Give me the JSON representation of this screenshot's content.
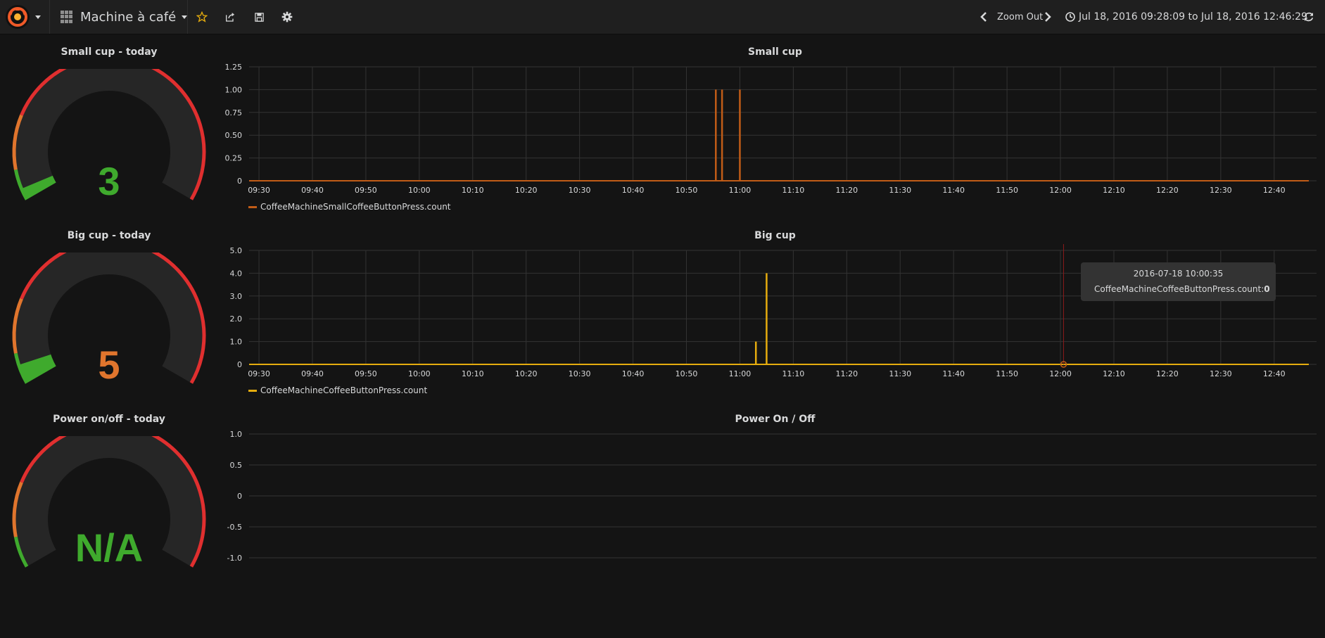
{
  "navbar": {
    "dashboard_title": "Machine à café",
    "zoom_out_label": "Zoom Out",
    "time_range": "Jul 18, 2016 09:28:09 to Jul 18, 2016 12:46:29"
  },
  "colors": {
    "background": "#141414",
    "navbar": "#1f1f1f",
    "gauge_red": "#e02f2f",
    "gauge_orange": "#e0752d",
    "gauge_green": "#3faa2d",
    "small_series": "#c15c17",
    "big_series": "#e5ac0e",
    "star": "#e5ac0e"
  },
  "icons": [
    "grafana-logo-icon",
    "dashboard-grid-icon",
    "star-icon",
    "share-icon",
    "save-icon",
    "cog-icon",
    "chevron-left-icon",
    "chevron-right-icon",
    "clock-icon",
    "refresh-icon"
  ],
  "gauges": [
    {
      "title": "Small cup - today",
      "value": "3",
      "numeric": 3,
      "value_color": "#3faa2d",
      "max": 100
    },
    {
      "title": "Big cup - today",
      "value": "5",
      "numeric": 5,
      "value_color": "#e0752d",
      "max": 100
    },
    {
      "title": "Power on/off - today",
      "value": "N/A",
      "numeric": null,
      "value_color": "#3faa2d",
      "max": 100
    }
  ],
  "graphs": {
    "small": {
      "title": "Small cup",
      "legend": "CoffeeMachineSmallCoffeeButtonPress.count"
    },
    "big": {
      "title": "Big cup",
      "legend": "CoffeeMachineCoffeeButtonPress.count"
    },
    "power": {
      "title": "Power On / Off"
    }
  },
  "tooltip": {
    "time": "2016-07-18 10:00:35",
    "series": "CoffeeMachineCoffeeButtonPress.count:",
    "value": "0"
  },
  "chart_data": [
    {
      "type": "line",
      "title": "Small cup",
      "x_ticks": [
        "09:30",
        "09:40",
        "09:50",
        "10:00",
        "10:10",
        "10:20",
        "10:30",
        "10:40",
        "10:50",
        "11:00",
        "11:10",
        "11:20",
        "11:30",
        "11:40",
        "11:50",
        "12:00",
        "12:10",
        "12:20",
        "12:30",
        "12:40"
      ],
      "y_ticks": [
        "0",
        "0.25",
        "0.50",
        "0.75",
        "1.00",
        "1.25"
      ],
      "ylim": [
        0,
        1.25
      ],
      "series": [
        {
          "name": "CoffeeMachineSmallCoffeeButtonPress.count",
          "color": "#c15c17",
          "spikes": [
            {
              "t": "10:55:30",
              "v": 1
            },
            {
              "t": "10:56:40",
              "v": 1
            },
            {
              "t": "11:00:00",
              "v": 1
            }
          ]
        }
      ]
    },
    {
      "type": "line",
      "title": "Big cup",
      "x_ticks": [
        "09:30",
        "09:40",
        "09:50",
        "10:00",
        "10:10",
        "10:20",
        "10:30",
        "10:40",
        "10:50",
        "11:00",
        "11:10",
        "11:20",
        "11:30",
        "11:40",
        "11:50",
        "12:00",
        "12:10",
        "12:20",
        "12:30",
        "12:40"
      ],
      "y_ticks": [
        "0",
        "1.0",
        "2.0",
        "3.0",
        "4.0",
        "5.0"
      ],
      "ylim": [
        0,
        5
      ],
      "series": [
        {
          "name": "CoffeeMachineCoffeeButtonPress.count",
          "color": "#e5ac0e",
          "spikes": [
            {
              "t": "11:03:00",
              "v": 1
            },
            {
              "t": "11:05:00",
              "v": 4
            }
          ]
        }
      ]
    },
    {
      "type": "line",
      "title": "Power On / Off",
      "y_ticks": [
        "-1.0",
        "-0.5",
        "0",
        "0.5",
        "1.0"
      ],
      "ylim": [
        -1,
        1
      ],
      "series": []
    }
  ]
}
